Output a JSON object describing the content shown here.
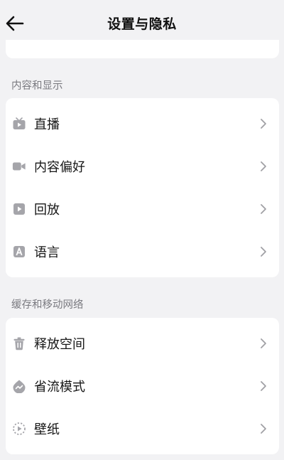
{
  "header": {
    "title": "设置与隐私",
    "back_icon": "arrow-left-icon"
  },
  "sections": [
    {
      "label": "内容和显示",
      "items": [
        {
          "label": "直播",
          "icon": "tv-icon"
        },
        {
          "label": "内容偏好",
          "icon": "video-camera-icon"
        },
        {
          "label": "回放",
          "icon": "play-square-icon"
        },
        {
          "label": "语言",
          "icon": "letter-a-icon"
        }
      ]
    },
    {
      "label": "缓存和移动网络",
      "items": [
        {
          "label": "释放空间",
          "icon": "trash-icon"
        },
        {
          "label": "省流模式",
          "icon": "data-saver-icon"
        },
        {
          "label": "壁纸",
          "icon": "wallpaper-play-icon"
        }
      ]
    }
  ],
  "colors": {
    "background": "#f2f2f4",
    "card": "#ffffff",
    "icon": "#a5a5aa",
    "section_label": "#7a7a80",
    "chevron": "#a0a0a5"
  }
}
